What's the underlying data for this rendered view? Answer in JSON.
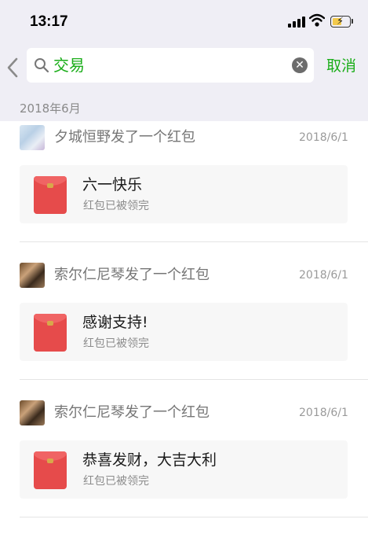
{
  "status_bar": {
    "time": "13:17"
  },
  "search": {
    "query": "交易",
    "cancel_label": "取消"
  },
  "date_header": "2018年6月",
  "items": [
    {
      "sender": "夕城恒野发了一个红包",
      "date": "2018/6/1",
      "title": "六一快乐",
      "status": "红包已被领完"
    },
    {
      "sender": "索尔仁尼琴发了一个红包",
      "date": "2018/6/1",
      "title": "感谢支持!",
      "status": "红包已被领完"
    },
    {
      "sender": "索尔仁尼琴发了一个红包",
      "date": "2018/6/1",
      "title": "恭喜发财，大吉大利",
      "status": "红包已被领完"
    }
  ],
  "colors": {
    "accent": "#1aad19",
    "header_bg": "#efeef5",
    "envelope": "#e64b4b"
  },
  "battery_level": 0.55
}
